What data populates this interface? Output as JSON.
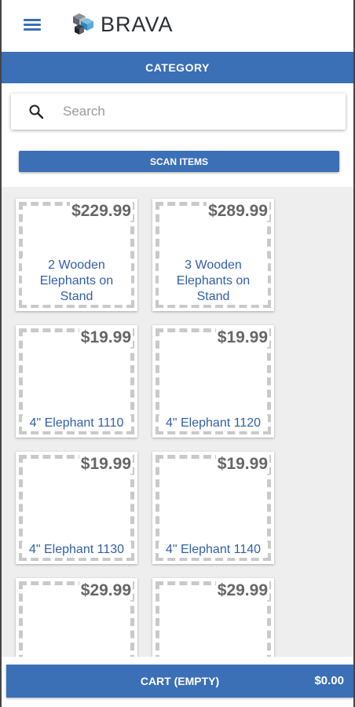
{
  "header": {
    "logo_text": "BRAVA",
    "menu_icon": "hamburger-menu-icon"
  },
  "category": {
    "label": "CATEGORY"
  },
  "search": {
    "placeholder": "Search",
    "value": ""
  },
  "scan": {
    "label": "SCAN ITEMS"
  },
  "products": [
    {
      "price": "$229.99",
      "name": "2 Wooden Elephants on Stand"
    },
    {
      "price": "$289.99",
      "name": "3 Wooden Elephants on Stand"
    },
    {
      "price": "$19.99",
      "name": "4\" Elephant 1110"
    },
    {
      "price": "$19.99",
      "name": "4\" Elephant 1120"
    },
    {
      "price": "$19.99",
      "name": "4\" Elephant 1130"
    },
    {
      "price": "$19.99",
      "name": "4\" Elephant 1140"
    },
    {
      "price": "$29.99",
      "name": ""
    },
    {
      "price": "$29.99",
      "name": ""
    }
  ],
  "cart": {
    "label": "CART (EMPTY)",
    "total": "$0.00"
  },
  "colors": {
    "accent": "#3b6fb6",
    "product_name": "#2f5fa6",
    "price": "#666666"
  }
}
